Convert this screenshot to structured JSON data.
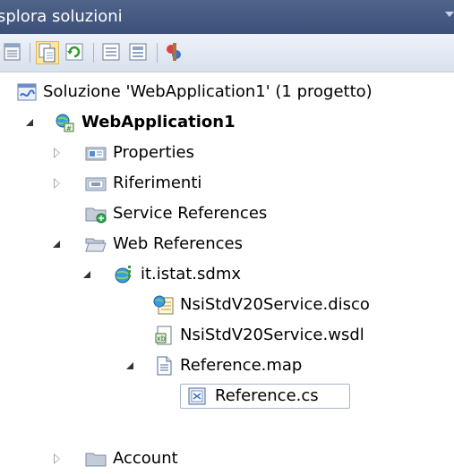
{
  "panel": {
    "title": "splora soluzioni"
  },
  "toolbar": {
    "buttons": [
      {
        "name": "properties-icon",
        "active": false
      },
      {
        "name": "show-all-files-icon",
        "active": true
      },
      {
        "name": "refresh-icon",
        "active": false
      },
      {
        "name": "view-code-icon",
        "active": false
      },
      {
        "name": "view-designer-icon",
        "active": false
      },
      {
        "name": "class-diagram-icon",
        "active": false
      }
    ]
  },
  "tree": {
    "items": [
      {
        "label": "Soluzione 'WebApplication1'  (1 progetto)",
        "icon": "solution-icon",
        "expander": "none",
        "bold": false
      },
      {
        "label": "WebApplication1",
        "icon": "web-project-icon",
        "expander": "expanded",
        "bold": true
      },
      {
        "label": "Properties",
        "icon": "properties-folder-icon",
        "expander": "collapsed",
        "bold": false
      },
      {
        "label": "Riferimenti",
        "icon": "references-folder-icon",
        "expander": "collapsed",
        "bold": false
      },
      {
        "label": "Service References",
        "icon": "service-references-folder-icon",
        "expander": "none",
        "bold": false
      },
      {
        "label": "Web References",
        "icon": "web-references-folder-icon",
        "expander": "expanded",
        "bold": false
      },
      {
        "label": "it.istat.sdmx",
        "icon": "web-reference-globe-icon",
        "expander": "expanded",
        "bold": false
      },
      {
        "label": "NsiStdV20Service.disco",
        "icon": "disco-file-icon",
        "expander": "none",
        "bold": false
      },
      {
        "label": "NsiStdV20Service.wsdl",
        "icon": "wsdl-file-icon",
        "expander": "none",
        "bold": false
      },
      {
        "label": "Reference.map",
        "icon": "map-file-icon",
        "expander": "expanded",
        "bold": false
      },
      {
        "label": "Reference.cs",
        "icon": "cs-file-icon",
        "expander": "none",
        "bold": false,
        "selected": true
      },
      {
        "label": "Account",
        "icon": "folder-icon",
        "expander": "collapsed",
        "bold": false
      }
    ]
  }
}
